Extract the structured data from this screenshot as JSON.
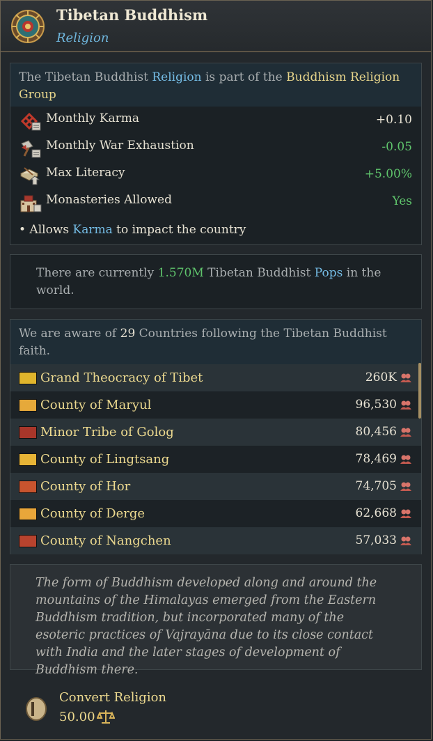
{
  "header": {
    "title": "Tibetan Buddhism",
    "subtitle": "Religion"
  },
  "info": {
    "intro_pre": "The Tibetan Buddhist ",
    "intro_link1": "Religion",
    "intro_mid": " is part of the ",
    "intro_link2": "Buddhism Religion Group",
    "stats": [
      {
        "label": "Monthly Karma",
        "value": "+0.10",
        "icon": "karma-knot-icon"
      },
      {
        "label": "Monthly War Exhaustion",
        "value": "-0.05",
        "icon": "war-exhaustion-icon"
      },
      {
        "label": "Max Literacy",
        "value": "+5.00%",
        "icon": "literacy-icon"
      },
      {
        "label": "Monasteries Allowed",
        "value": "Yes",
        "icon": "monastery-icon"
      }
    ],
    "karma_pre": "• Allows ",
    "karma_link": "Karma",
    "karma_post": " to impact the country"
  },
  "pops": {
    "pre": "There are currently ",
    "count": "1.570M",
    "mid": " Tibetan Buddhist ",
    "link": "Pops",
    "post": " in the world."
  },
  "countries": {
    "intro_pre": "We are aware of ",
    "count": "29",
    "intro_post": " Countries following the Tibetan Buddhist faith.",
    "list": [
      {
        "name": "Grand Theocracy of Tibet",
        "pop": "260K",
        "flag": "#e0b52c"
      },
      {
        "name": "County of Maryul",
        "pop": "96,530",
        "flag": "#e6a93a"
      },
      {
        "name": "Minor Tribe of Golog",
        "pop": "80,456",
        "flag": "#a8362a"
      },
      {
        "name": "County of Lingtsang",
        "pop": "78,469",
        "flag": "#e7b436"
      },
      {
        "name": "County of Hor",
        "pop": "74,705",
        "flag": "#c8542e"
      },
      {
        "name": "County of Derge",
        "pop": "62,668",
        "flag": "#e9a63a"
      },
      {
        "name": "County of Nangchen",
        "pop": "57,033",
        "flag": "#b8432e"
      }
    ]
  },
  "description": "The form of Buddhism developed along and around the mountains of the Himalayas emerged from the Eastern Buddhism tradition, but incorporated many of the esoteric practices of Vajrayāna due to its close contact with India and the later stages of development of Buddhism there.",
  "convert": {
    "label": "Convert Religion",
    "cost": "50.00"
  }
}
